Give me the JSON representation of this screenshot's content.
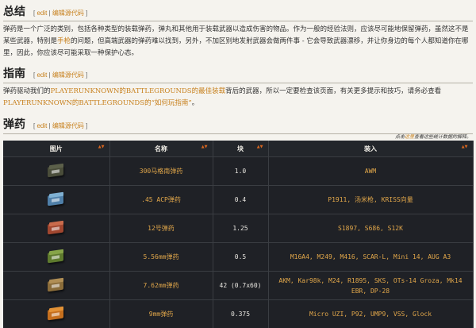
{
  "summary": {
    "title": "总结",
    "edit_label": "edit",
    "edit_code_label": "编辑源代码",
    "paragraph_before": "弹药是一个广泛的类别，包括各种类型的装载弹药，弹丸和其他用于装载武器以造成伤害的物品。作为一般的经验法则，应该尽可能地保留弹药，虽然这不是某些武器，特别是",
    "paragraph_link": "手枪",
    "paragraph_after": "的问题，但高端武器的弹药难以找到，另外，不加区别地发射武器会做两件事 - 它会导致武器漂移，并让你身边的每个人都知道你在哪里，因此，你应该尽可能采取一种保护心态。"
  },
  "guide": {
    "title": "指南",
    "edit_label": "edit",
    "edit_code_label": "编辑源代码",
    "p1": "弹药驱动我们的",
    "link1": "PLAYERUNKNOWN的BATTLEGROUNDS的最佳装载",
    "p2": "背后的武器，所以一定要检查该页面，有关更多提示和技巧，请务必查看",
    "link2": "PLAYERUNKNOWN的BATTLEGROUNDS的“如何玩指南”",
    "p3": "。"
  },
  "ammo": {
    "title": "弹药",
    "edit_label": "edit",
    "edit_code_label": "编辑源代码",
    "note_before": "点击",
    "note_link": "这里",
    "note_after": "查看这些统计数据的解释。",
    "columns": [
      "图片",
      "名称",
      "块",
      "装入"
    ],
    "rows": [
      {
        "name": "300马格南弹药",
        "block": "1.0",
        "fits": "AWM",
        "icon": "ammo-box-300-icon",
        "color": "#4a4d3a",
        "lid": "#5c604a"
      },
      {
        "name": ".45 ACP弹药",
        "block": "0.4",
        "fits": "P1911, 汤米枪, KRISS向量",
        "icon": "ammo-box-45acp-icon",
        "color": "#4f7fa8",
        "lid": "#7fb0d2"
      },
      {
        "name": "12号弹药",
        "block": "1.25",
        "fits": "S1897, S686, S12K",
        "icon": "ammo-box-12gauge-icon",
        "color": "#a0462f",
        "lid": "#c96b4c"
      },
      {
        "name": "5.56mm弹药",
        "block": "0.5",
        "fits": "M16A4, M249, M416, SCAR-L, Mini 14, AUG A3",
        "icon": "ammo-box-556-icon",
        "color": "#5e7a2e",
        "lid": "#86a448"
      },
      {
        "name": "7.62mm弹药",
        "block": "42 (0.7x60)",
        "fits": "AKM, Kar98k, M24, R1895, SKS, OTs-14 Groza, Mk14 EBR, DP-28",
        "icon": "ammo-box-762-icon",
        "color": "#8a6c3a",
        "lid": "#b08e55"
      },
      {
        "name": "9mm弹药",
        "block": "0.375",
        "fits": "Micro UZI, P92, UMP9, VSS, Glock",
        "icon": "ammo-box-9mm-icon",
        "color": "#c56f1e",
        "lid": "#e39236"
      }
    ]
  }
}
